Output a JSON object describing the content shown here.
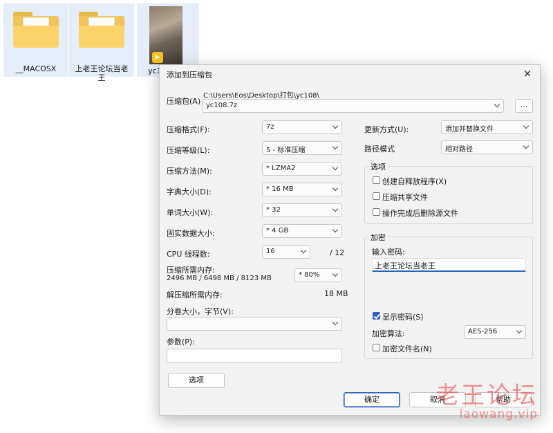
{
  "desktop": {
    "items": [
      {
        "label": "__MACOSX",
        "kind": "folder"
      },
      {
        "label": "上老王论坛当老王",
        "kind": "folder"
      },
      {
        "label": "yc1",
        "kind": "image"
      }
    ]
  },
  "dialog": {
    "title": "添加到压缩包",
    "close_icon": "×",
    "archive_label": "压缩包(A)",
    "archive_path": "C:\\Users\\Eos\\Desktop\\打包\\yc108\\",
    "archive_name": "yc108.7z",
    "browse_label": "...",
    "left": {
      "format_label": "压缩格式(F):",
      "format_value": "7z",
      "level_label": "压缩等级(L):",
      "level_value": "5 - 标准压缩",
      "method_label": "压缩方法(M):",
      "method_value": "* LZMA2",
      "dict_label": "字典大小(D):",
      "dict_value": "* 16 MB",
      "word_label": "单词大小(W):",
      "word_value": "* 32",
      "solid_label": "固实数据大小:",
      "solid_value": "* 4 GB",
      "cpu_label": "CPU 线程数:",
      "cpu_value": "16",
      "cpu_max": "/ 12",
      "mem_label": "压缩所需内存:",
      "mem_detail": "2496 MB / 6498 MB / 8123 MB",
      "mem_percent": "* 80%",
      "decomp_label": "解压缩所需内存:",
      "decomp_value": "18 MB",
      "split_label": "分卷大小，字节(V):",
      "split_value": "",
      "params_label": "参数(P):",
      "params_value": "",
      "options_button": "选项"
    },
    "right": {
      "update_label": "更新方式(U):",
      "update_value": "添加并替换文件",
      "path_label": "路径模式",
      "path_value": "相对路径",
      "options_group": "选项",
      "opt_sfx": "创建自释放程序(X)",
      "opt_shared": "压缩共享文件",
      "opt_delete": "操作完成后删除源文件",
      "encrypt_group": "加密",
      "password_label": "输入密码:",
      "password_value": "上老王论坛当老王",
      "show_password": "显示密码(S)",
      "algo_label": "加密算法:",
      "algo_value": "AES-256",
      "encrypt_names": "加密文件名(N)"
    },
    "buttons": {
      "ok": "确定",
      "cancel": "取消",
      "help": "帮助"
    }
  },
  "watermark": {
    "cn": "老王论坛",
    "en": "laowang.vip"
  },
  "colors": {
    "accent": "#2a62c8",
    "folder": "#f0c45a",
    "watermark": "#e63c3c"
  }
}
